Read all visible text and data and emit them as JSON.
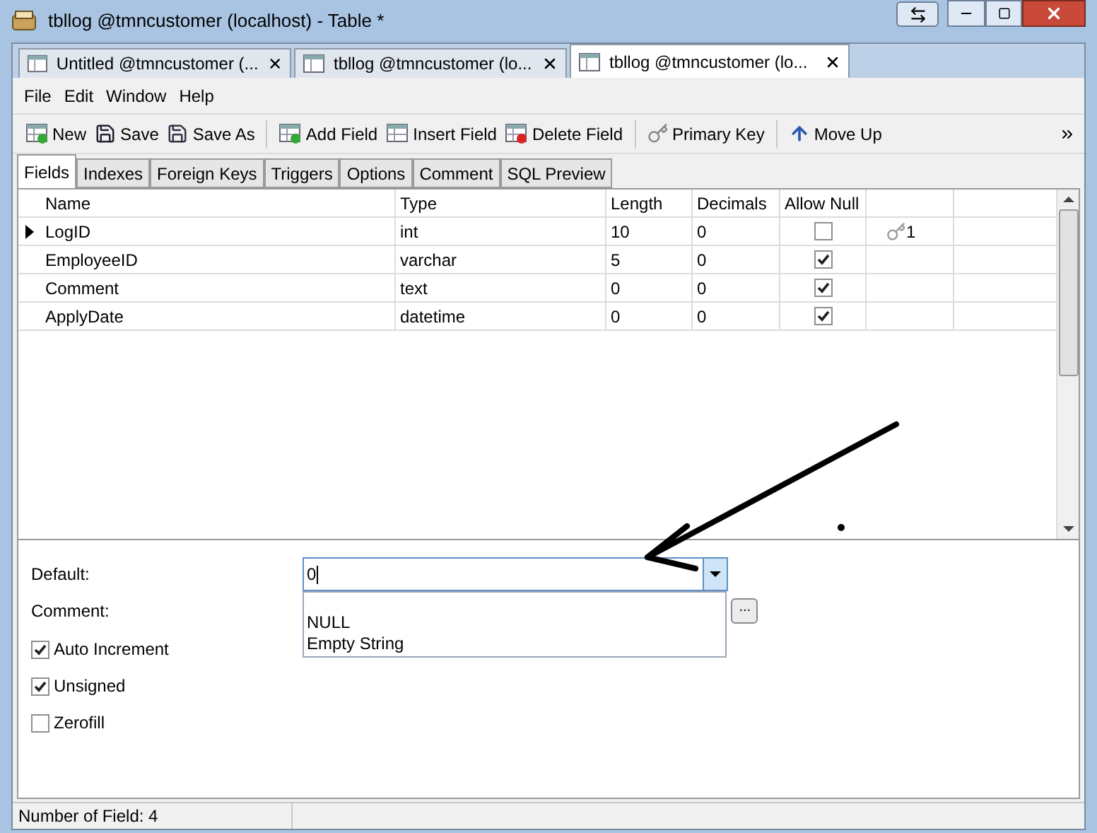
{
  "window": {
    "title": "tbllog @tmncustomer (localhost) - Table *"
  },
  "doc_tabs": [
    {
      "label": "Untitled @tmncustomer (...",
      "selected": false
    },
    {
      "label": "tbllog @tmncustomer (lo...",
      "selected": false
    },
    {
      "label": "tbllog @tmncustomer (lo...",
      "selected": true
    }
  ],
  "menu": [
    "File",
    "Edit",
    "Window",
    "Help"
  ],
  "toolbar": [
    {
      "kind": "new",
      "label": "New"
    },
    {
      "kind": "save",
      "label": "Save"
    },
    {
      "kind": "saveas",
      "label": "Save As"
    },
    {
      "kind": "add",
      "label": "Add Field"
    },
    {
      "kind": "insert",
      "label": "Insert Field"
    },
    {
      "kind": "delete",
      "label": "Delete Field"
    },
    {
      "kind": "key",
      "label": "Primary Key"
    },
    {
      "kind": "up",
      "label": "Move Up"
    }
  ],
  "field_tabs": [
    {
      "label": "Fields",
      "selected": true
    },
    {
      "label": "Indexes",
      "selected": false
    },
    {
      "label": "Foreign Keys",
      "selected": false
    },
    {
      "label": "Triggers",
      "selected": false
    },
    {
      "label": "Options",
      "selected": false
    },
    {
      "label": "Comment",
      "selected": false
    },
    {
      "label": "SQL Preview",
      "selected": false
    }
  ],
  "table": {
    "columns": [
      "Name",
      "Type",
      "Length",
      "Decimals",
      "Allow Null"
    ],
    "rows": [
      {
        "name": "LogID",
        "type": "int",
        "length": "10",
        "decimals": "0",
        "allow_null": false,
        "key": "1",
        "selected": true
      },
      {
        "name": "EmployeeID",
        "type": "varchar",
        "length": "5",
        "decimals": "0",
        "allow_null": true,
        "selected": false
      },
      {
        "name": "Comment",
        "type": "text",
        "length": "0",
        "decimals": "0",
        "allow_null": true,
        "selected": false
      },
      {
        "name": "ApplyDate",
        "type": "datetime",
        "length": "0",
        "decimals": "0",
        "allow_null": true,
        "selected": false
      }
    ]
  },
  "properties": {
    "default_label": "Default:",
    "default_value": "0",
    "dropdown_options": [
      "NULL",
      "Empty String"
    ],
    "comment_label": "Comment:",
    "comment_button": "...",
    "checkboxes": [
      {
        "label": "Auto Increment",
        "checked": true
      },
      {
        "label": "Unsigned",
        "checked": true
      },
      {
        "label": "Zerofill",
        "checked": false
      }
    ]
  },
  "status_bar": "Number of Field: 4"
}
